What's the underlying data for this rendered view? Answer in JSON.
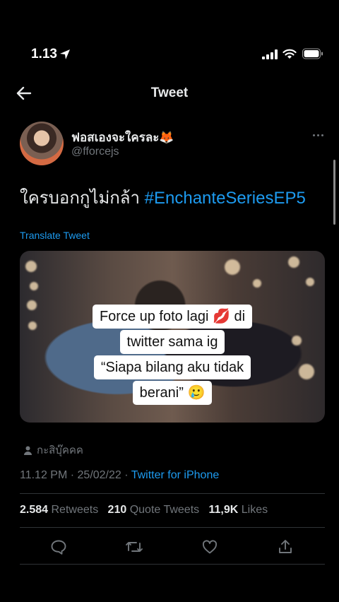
{
  "status_bar": {
    "time": "1.13"
  },
  "header": {
    "title": "Tweet"
  },
  "author": {
    "name": "ฟอสเองจะใครละ🦊",
    "handle": "@fforcejs"
  },
  "tweet": {
    "text": "ใครบอกกูไม่กล้า ",
    "hashtag": "#EnchanteSeriesEP5",
    "translate_label": "Translate Tweet"
  },
  "media_overlay": {
    "lines": [
      "Force up foto lagi 💋 di",
      "twitter sama ig",
      "“Siapa bilang aku tidak",
      "berani” 🥲"
    ]
  },
  "meta": {
    "reply_user": "กะสิบุ๊คคค",
    "timestamp": "11.12 PM · 25/02/22 · ",
    "source": "Twitter for iPhone"
  },
  "stats": {
    "retweets_count": "2.584",
    "retweets_label": "Retweets",
    "quotes_count": "210",
    "quotes_label": "Quote Tweets",
    "likes_count": "11,9K",
    "likes_label": "Likes"
  },
  "icons": {
    "back": "arrow-left-icon",
    "more": "more-horizontal-icon",
    "reply": "reply-icon",
    "retweet": "retweet-icon",
    "like": "heart-icon",
    "share": "share-icon"
  },
  "colors": {
    "accent": "#1d9bf0",
    "secondary_text": "#71767b",
    "background": "#000000"
  }
}
